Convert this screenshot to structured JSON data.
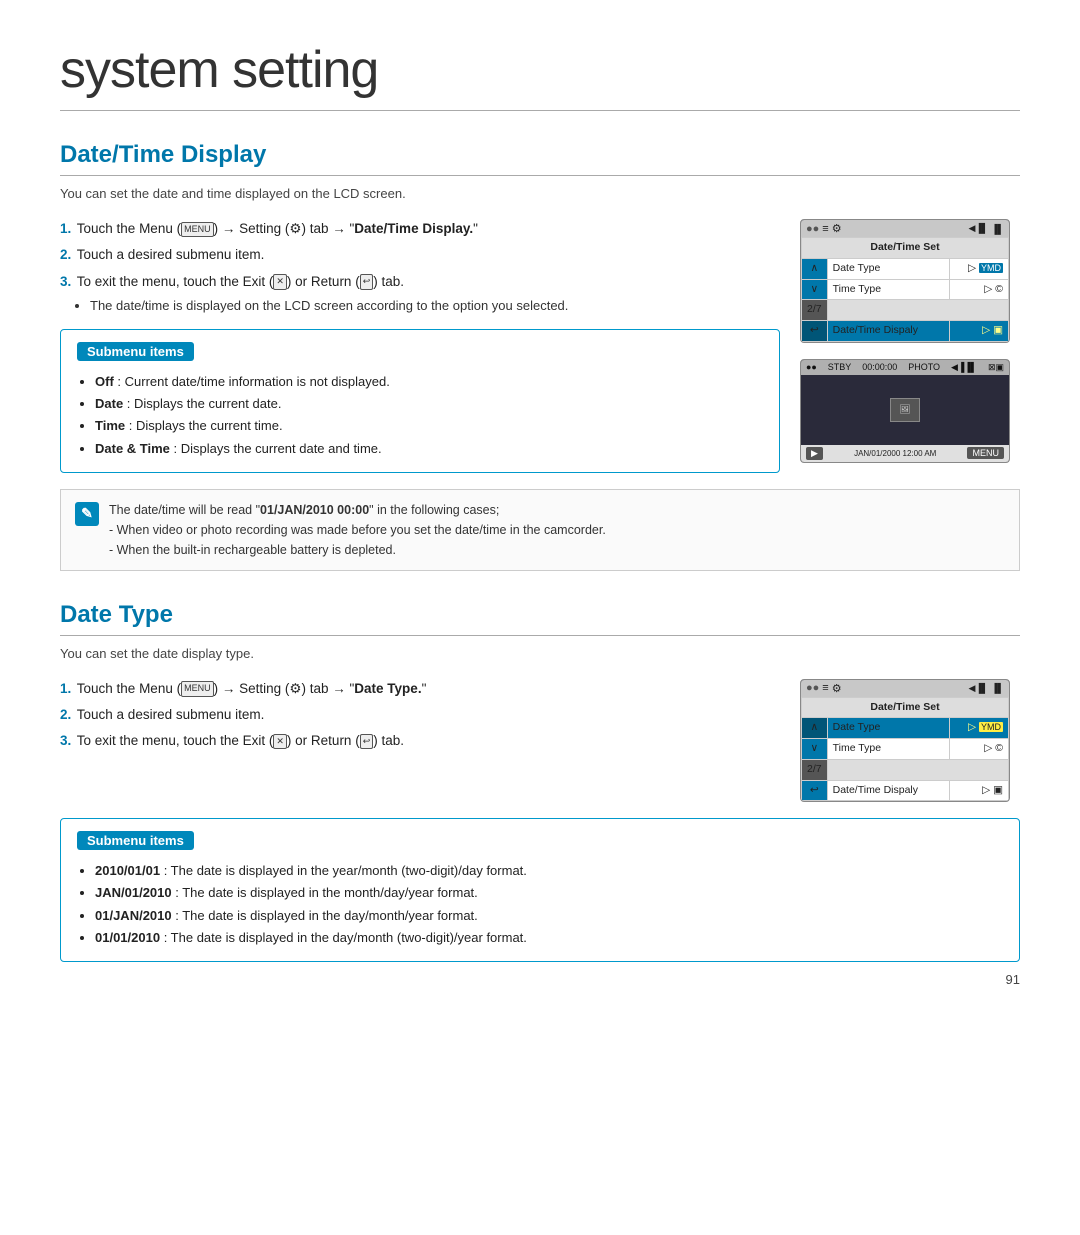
{
  "page": {
    "title": "system setting",
    "page_number": "91"
  },
  "section1": {
    "heading": "Date/Time Display",
    "description": "You can set the date and time displayed on the LCD screen.",
    "steps": [
      {
        "num": "1.",
        "text": "Touch the Menu (",
        "icon": "MENU",
        "text2": ") → Setting (",
        "icon2": "⚙",
        "text3": ") tab → \"Date/Time Display.\""
      },
      {
        "num": "2.",
        "text": "Touch a desired submenu item."
      },
      {
        "num": "3.",
        "text": "To exit the menu, touch the Exit (",
        "icon": "✕",
        "text2": ") or Return (",
        "icon2": "↩",
        "text3": ") tab.",
        "subbullet": "The date/time is displayed on the LCD screen according to the option you selected."
      }
    ],
    "submenu_title": "Submenu items",
    "submenu_items": [
      {
        "bold": "Off",
        "text": " : Current date/time information is not displayed."
      },
      {
        "bold": "Date",
        "text": " : Displays the current date."
      },
      {
        "bold": "Time",
        "text": " : Displays the current time."
      },
      {
        "bold": "Date & Time",
        "text": " : Displays the current date and time."
      }
    ],
    "note": {
      "icon": "✎",
      "lines": [
        "The date/time will be read \"01/JAN/2010 00:00\" in the following cases;",
        "- When video or photo recording was made before you set the date/time in the camcorder.",
        "- When the built-in rechargeable battery is depleted."
      ]
    },
    "screenshot1": {
      "topbar_icons": [
        "●●",
        "≡",
        "⚙",
        "◀▐▐▌"
      ],
      "menu_header": "Date/Time Set",
      "menu_rows": [
        {
          "nav": "∧",
          "label": "Date Type",
          "value": "▷ YMD",
          "highlight": false
        },
        {
          "nav": "∨",
          "label": "Time Type",
          "value": "▷ ©",
          "highlight": false
        },
        {
          "counter": "2/7"
        },
        {
          "nav": "↩",
          "label": "Date/Time Dispaly",
          "value": "▷ ▣",
          "highlight": true
        }
      ]
    },
    "screenshot2": {
      "topbar": "●● STBY 00:00:00 PHOTO ◀▐▐▌",
      "topbar2": "⊠ ▣",
      "screen_area": true,
      "bottombar_left": "▶",
      "bottombar_date": "JAN/01/2000 12:00 AM",
      "bottombar_menu": "MENU"
    }
  },
  "section2": {
    "heading": "Date Type",
    "description": "You can set the date display type.",
    "steps": [
      {
        "num": "1.",
        "text": "Touch the Menu (",
        "icon": "MENU",
        "text2": ") → Setting (",
        "icon2": "⚙",
        "text3": ") tab → \"Date Type.\""
      },
      {
        "num": "2.",
        "text": "Touch a desired submenu item."
      },
      {
        "num": "3.",
        "text": "To exit the menu, touch the Exit (",
        "icon": "✕",
        "text2": ") or Return (",
        "icon2": "↩",
        "text3": ") tab."
      }
    ],
    "submenu_title": "Submenu items",
    "submenu_items": [
      {
        "bold": "2010/01/01",
        "text": " : The date is displayed in the year/month (two-digit)/day format."
      },
      {
        "bold": "JAN/01/2010",
        "text": " : The date is displayed in the month/day/year format."
      },
      {
        "bold": "01/JAN/2010",
        "text": " : The date is displayed in the day/month/year format."
      },
      {
        "bold": "01/01/2010",
        "text": " : The date is displayed in the day/month (two-digit)/year format."
      }
    ],
    "screenshot": {
      "topbar_icons": [
        "●●",
        "≡",
        "⚙",
        "◀▐▐▌"
      ],
      "menu_header": "Date/Time Set",
      "menu_rows": [
        {
          "nav": "∧",
          "label": "Date Type",
          "value": "▷ YMD",
          "highlight": true
        },
        {
          "nav": "∨",
          "label": "Time Type",
          "value": "▷ ©",
          "highlight": false
        },
        {
          "counter": "2/7"
        },
        {
          "nav": "↩",
          "label": "Date/Time Dispaly",
          "value": "▷ ▣",
          "highlight": false
        }
      ]
    }
  }
}
